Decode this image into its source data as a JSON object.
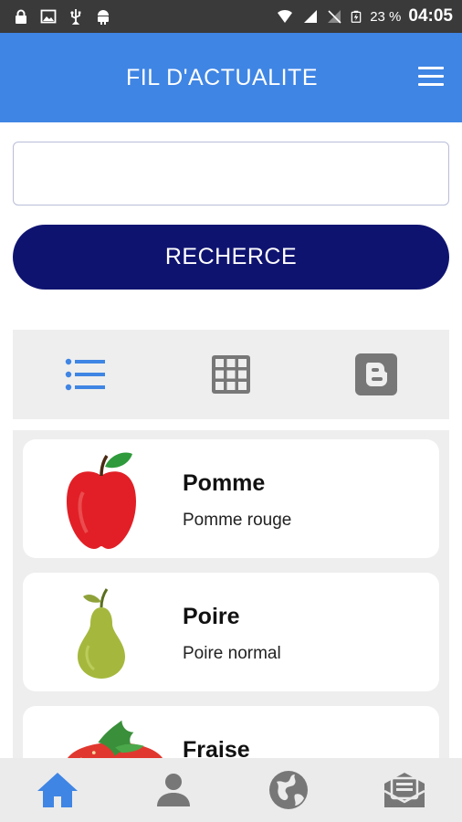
{
  "status_bar": {
    "battery": "23 %",
    "time": "04:05",
    "icons": [
      "lock-icon",
      "image-icon",
      "usb-icon",
      "android-icon",
      "wifi-icon",
      "signal-icon",
      "no-signal-icon",
      "battery-icon"
    ]
  },
  "app_bar": {
    "title": "FIL D'ACTUALITE",
    "menu_icon": "hamburger-menu-icon",
    "color": "#3f85e4"
  },
  "search": {
    "value": "",
    "placeholder": "",
    "button_label": "RECHERCE",
    "button_color": "#0f1370"
  },
  "view_toggle": {
    "options": [
      {
        "icon": "list-view-icon",
        "active": true
      },
      {
        "icon": "grid-view-icon",
        "active": false
      },
      {
        "icon": "blog-view-icon",
        "active": false
      }
    ],
    "active_color": "#3f85e4",
    "inactive_color": "#777777"
  },
  "items": [
    {
      "name": "Pomme",
      "description": "Pomme rouge",
      "icon": "apple-icon"
    },
    {
      "name": "Poire",
      "description": "Poire normal",
      "icon": "pear-icon"
    },
    {
      "name": "Fraise",
      "description": "",
      "icon": "strawberry-icon"
    }
  ],
  "bottom_nav": {
    "items": [
      {
        "icon": "home-icon",
        "active": true
      },
      {
        "icon": "person-icon",
        "active": false
      },
      {
        "icon": "globe-icon",
        "active": false
      },
      {
        "icon": "message-icon",
        "active": false
      }
    ]
  }
}
